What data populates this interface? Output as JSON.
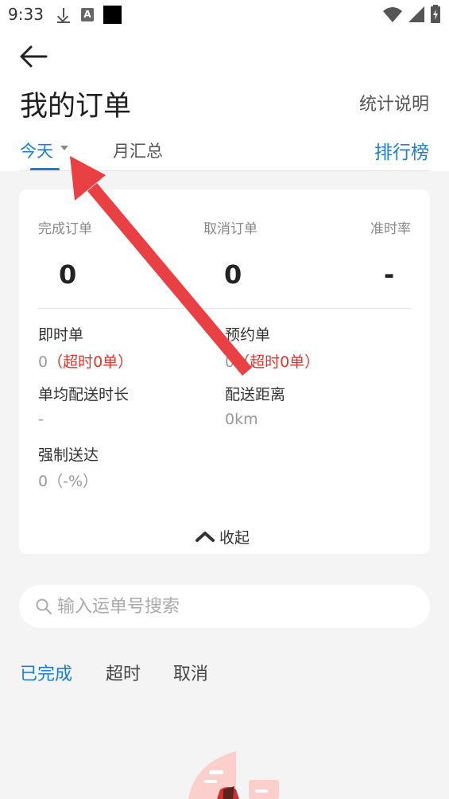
{
  "status_bar": {
    "time": "9:33"
  },
  "header": {
    "title": "我的订单",
    "stats_explain": "统计说明",
    "tabs": {
      "today": "今天",
      "month": "月汇总"
    },
    "ranking": "排行榜"
  },
  "summary": {
    "metrics": [
      {
        "label": "完成订单",
        "value": "0"
      },
      {
        "label": "取消订单",
        "value": "0"
      },
      {
        "label": "准时率",
        "value": "-"
      }
    ],
    "details": {
      "instant_label": "即时单",
      "instant_value": "0",
      "instant_note": "（超时0单）",
      "reserved_label": "预约单",
      "reserved_value": "0",
      "reserved_note": "（超时0单）",
      "avg_time_label": "单均配送时长",
      "avg_time_value": "-",
      "distance_label": "配送距离",
      "distance_value": "0km",
      "forced_label": "强制送达",
      "forced_value": "0（-%）"
    },
    "collapse": "收起"
  },
  "search": {
    "placeholder": "输入运单号搜索"
  },
  "filters": [
    "已完成",
    "超时",
    "取消"
  ],
  "colors": {
    "accent": "#1a7fd4",
    "alert": "#e0362e",
    "annotation": "#e84043"
  },
  "icons": [
    "download-icon",
    "a-box-icon",
    "black-square-icon",
    "wifi-icon",
    "signal-icon",
    "battery-icon",
    "back-arrow-icon",
    "caret-down-icon",
    "chevron-up-icon",
    "search-icon"
  ]
}
